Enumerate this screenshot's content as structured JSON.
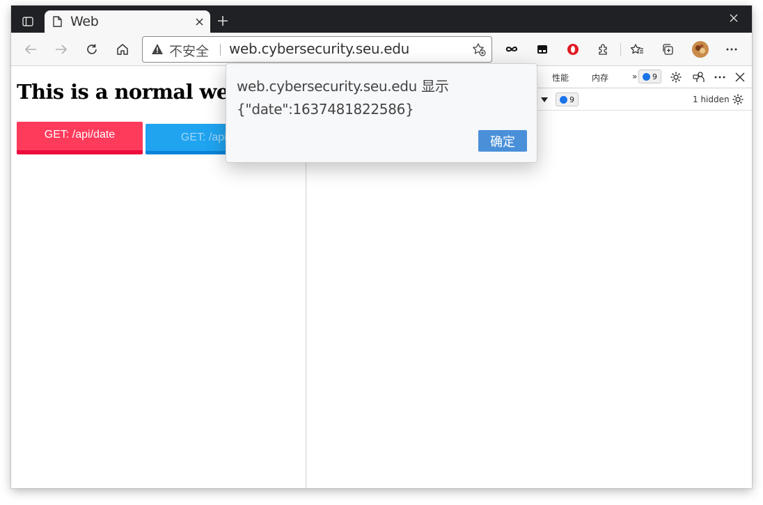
{
  "browser": {
    "tab": {
      "title": "Web",
      "icon": "document-icon"
    },
    "address_bar": {
      "security_label": "不安全",
      "url": "web.cybersecurity.seu.edu"
    },
    "toolbar_icons": [
      "back-icon",
      "forward-icon",
      "refresh-icon",
      "home-icon",
      "add-favorite-icon",
      "infinity-extension-icon",
      "tab-extension-icon",
      "opera-extension-icon",
      "extensions-icon",
      "favorites-icon",
      "collections-icon",
      "profile-avatar",
      "more-icon"
    ]
  },
  "page": {
    "heading": "This is a normal web,",
    "buttons": [
      {
        "label": "GET: /api/date",
        "color": "#ff3b5c"
      },
      {
        "label": "GET: /api/d",
        "color": "#20a4f0"
      }
    ]
  },
  "devtools": {
    "tabs": [
      "性能",
      "内存"
    ],
    "more_tabs": "»",
    "issue_badge_count": "9",
    "console_badge_count": "9",
    "hidden_count": "1 hidden"
  },
  "dialog": {
    "title": "web.cybersecurity.seu.edu 显示",
    "message": "{\"date\":1637481822586}",
    "ok_label": "确定",
    "ok_color": "#4a90d9"
  }
}
